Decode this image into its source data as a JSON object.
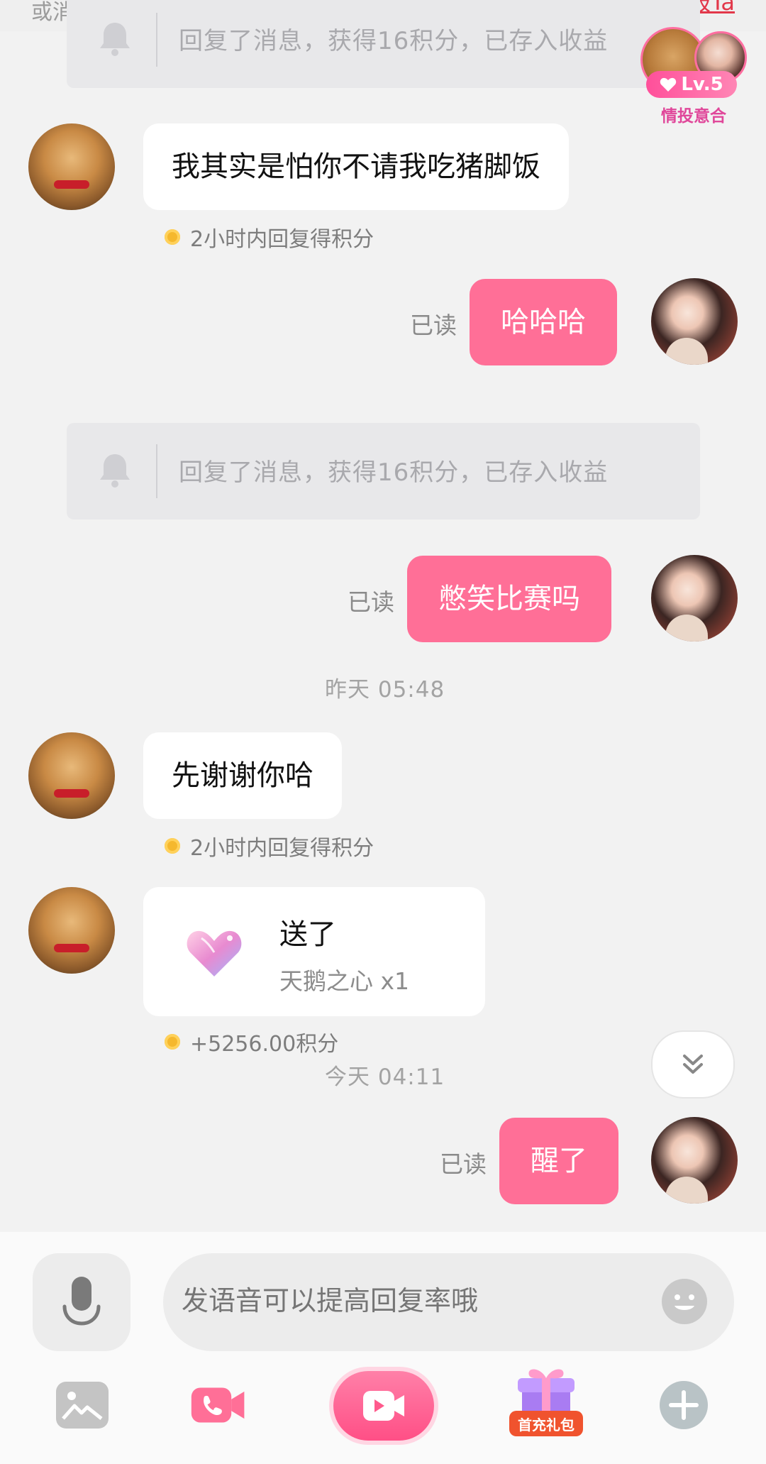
{
  "top": {
    "left_text": "或消费",
    "right_link": "举报Ta"
  },
  "intimacy": {
    "level": "Lv.5",
    "tag": "情投意合"
  },
  "notices": [
    {
      "text": "回复了消息，获得16积分，已存入收益"
    },
    {
      "text": "回复了消息，获得16积分，已存入收益"
    }
  ],
  "messages": {
    "m1": {
      "text": "我其实是怕你不请我吃猪脚饭",
      "points": "2小时内回复得积分"
    },
    "m2": {
      "text": "哈哈哈",
      "status": "已读"
    },
    "m3": {
      "text": "憋笑比赛吗",
      "status": "已读"
    },
    "time1": "昨天 05:48",
    "m4": {
      "text": "先谢谢你哈",
      "points": "2小时内回复得积分"
    },
    "gift": {
      "title": "送了",
      "item": "天鹅之心 x1",
      "points": "+5256.00积分"
    },
    "time2": "今天 04:11",
    "m5": {
      "text": "醒了",
      "status": "已读"
    }
  },
  "input": {
    "placeholder": "发语音可以提高回复率哦"
  },
  "toolbar": {
    "items": [
      "image-icon",
      "video-call-icon",
      "live-icon",
      "gift-pack-icon",
      "plus-icon"
    ],
    "gift_pack_label": "首充礼包"
  },
  "colors": {
    "accent_pink": "#ff6f97",
    "background": "#f2f2f2"
  }
}
